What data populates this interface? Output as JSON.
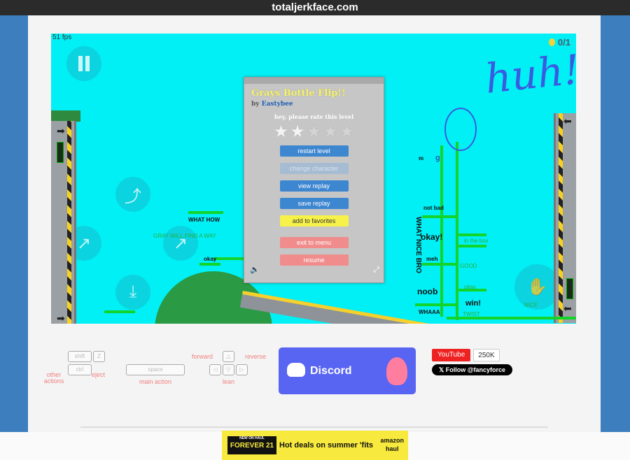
{
  "browser": {
    "domain": "totaljerkface.com"
  },
  "hud": {
    "fps": "51 fps",
    "coins": "0/1"
  },
  "level_menu": {
    "title": "Grays Bottle Flip!!",
    "by_label": "by",
    "author": "Eastybee",
    "rate_prompt": "hey, please rate this level",
    "rating_stars_filled": 2,
    "rating_stars_total": 5,
    "buttons": {
      "restart": "restart level",
      "change_character": "change character",
      "view_replay": "view replay",
      "save_replay": "save replay",
      "add_favorites": "add to favorites",
      "exit_menu": "exit to menu",
      "resume": "resume"
    }
  },
  "level_text": {
    "what_how": "WHAT HOW",
    "gray_find_way": "GRAY WILL FIND A WAY",
    "okay_left": "okay",
    "not_bad": "not bad",
    "okay_right": "okay!",
    "meh": "meh",
    "noob": "noob",
    "whaaa": "WHAAA",
    "win": "win!",
    "what_nice_bro": "WHAT NICE BRO",
    "m": "m",
    "g": "g",
    "huh": "huh!",
    "good": "GOOD",
    "nice": "NICE",
    "in_the_box": "in the box",
    "okay_small": "okay",
    "twist": "TWIST"
  },
  "controls_help": {
    "shift": "shift",
    "z": "Z",
    "ctrl": "ctrl",
    "space": "space",
    "other_actions": "other actions",
    "eject": "eject",
    "main_action": "main action",
    "forward": "forward",
    "reverse": "reverse",
    "lean": "lean"
  },
  "social": {
    "discord": "Discord",
    "youtube": "YouTube",
    "youtube_count": "250K",
    "twitter": "𝕏 Follow @fancyforce"
  },
  "ad": {
    "badge": "NEW ON HAUL",
    "brand": "FOREVER 21",
    "text": "Hot deals on summer 'fits",
    "partner_line1": "amazon",
    "partner_line2": "haul"
  },
  "colors": {
    "sky": "#00f0f5",
    "green": "#13d42a",
    "menu_button": "#3d86d0",
    "accent_yellow": "#f6f24a",
    "exit_red": "#f18c8c",
    "doodle_blue": "#3a5be0"
  }
}
